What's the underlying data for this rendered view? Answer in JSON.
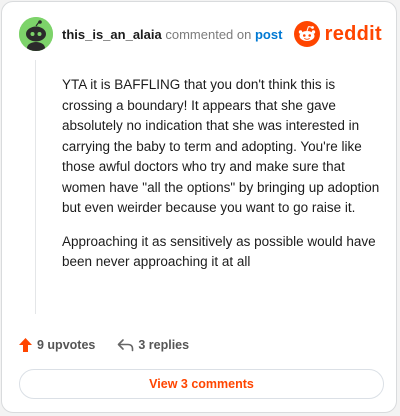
{
  "comment": {
    "username": "this_is_an_alaia",
    "commented_text": "commented on",
    "post_link": "post",
    "brand": "reddit",
    "paragraphs": [
      "YTA it is BAFFLING that you don't think this is crossing a boundary! It appears that she gave absolutely no indication that she was interested in carrying the baby to term and adopting. You're like those awful doctors who try and make sure that women have \"all the options\" by bringing up adoption but even weirder because you want to go raise it.",
      "Approaching it as sensitively as possible would have been never approaching it at all"
    ],
    "upvotes": "9 upvotes",
    "replies": "3 replies",
    "view_comments": "View 3 comments"
  },
  "colors": {
    "accent": "#ff4500",
    "link": "#0079d3",
    "avatar_bg": "#7dd36a"
  },
  "icons": [
    "snoo-avatar-icon",
    "reddit-logo-icon",
    "upvote-arrow-icon",
    "reply-arrow-icon"
  ]
}
